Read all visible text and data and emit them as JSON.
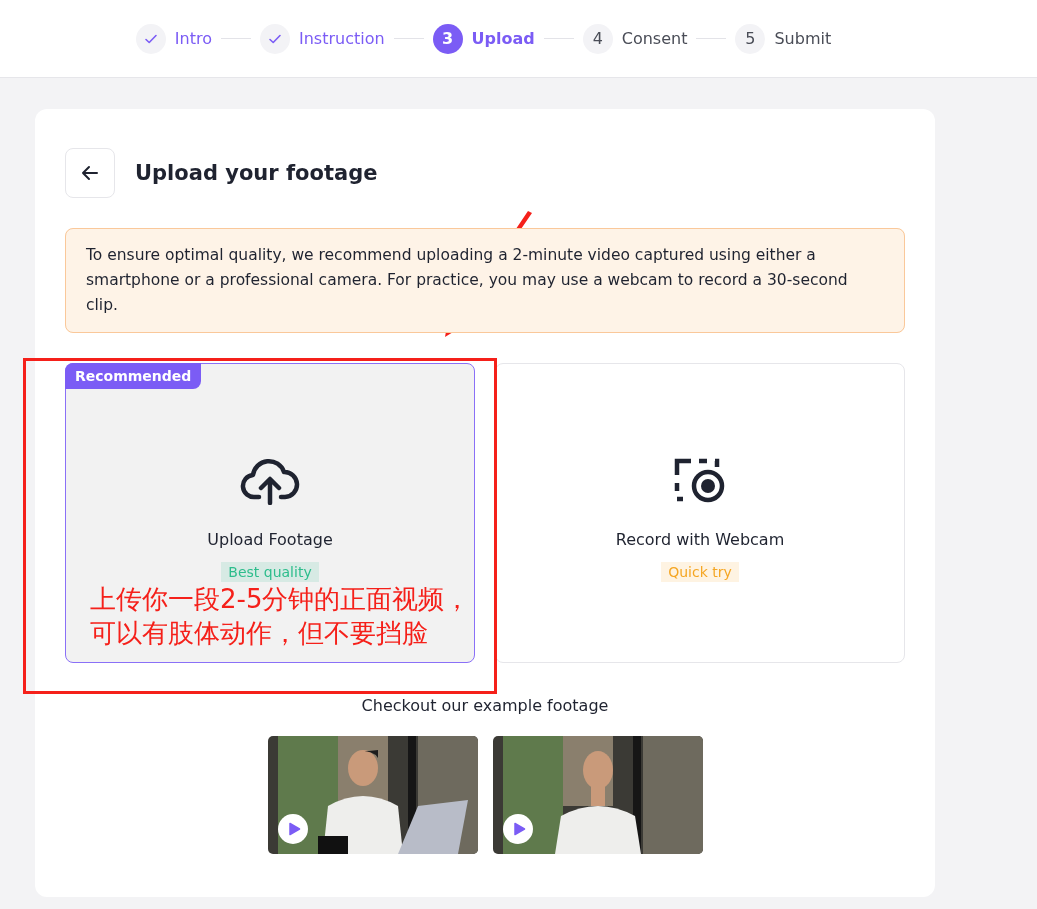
{
  "steps": [
    {
      "label": "Intro",
      "completed": true,
      "selected": false
    },
    {
      "label": "Instruction",
      "completed": true,
      "selected": false
    },
    {
      "label": "Upload",
      "number": "3",
      "completed": false,
      "selected": true
    },
    {
      "label": "Consent",
      "number": "4",
      "completed": false,
      "selected": false
    },
    {
      "label": "Submit",
      "number": "5",
      "completed": false,
      "selected": false
    }
  ],
  "page": {
    "title": "Upload your footage"
  },
  "notice": "To ensure optimal quality, we recommend uploading a 2-minute video captured using either a smartphone or a professional camera. For practice, you may use a webcam to record a 30-second clip.",
  "options": [
    {
      "kind": "upload",
      "title": "Upload Footage",
      "badge": "Recommended",
      "selected": true,
      "tag": {
        "text": "Best quality",
        "color": "#2dbd8c"
      }
    },
    {
      "kind": "webcam",
      "title": "Record with Webcam",
      "selected": false,
      "tag": {
        "text": "Quick try",
        "color": "#f5a623"
      }
    }
  ],
  "examples": {
    "heading": "Checkout our example footage"
  },
  "annotation": {
    "lines": [
      "上传你一段2-5分钟的正面视频，",
      "可以有肢体动作，但不要挡脸"
    ]
  }
}
